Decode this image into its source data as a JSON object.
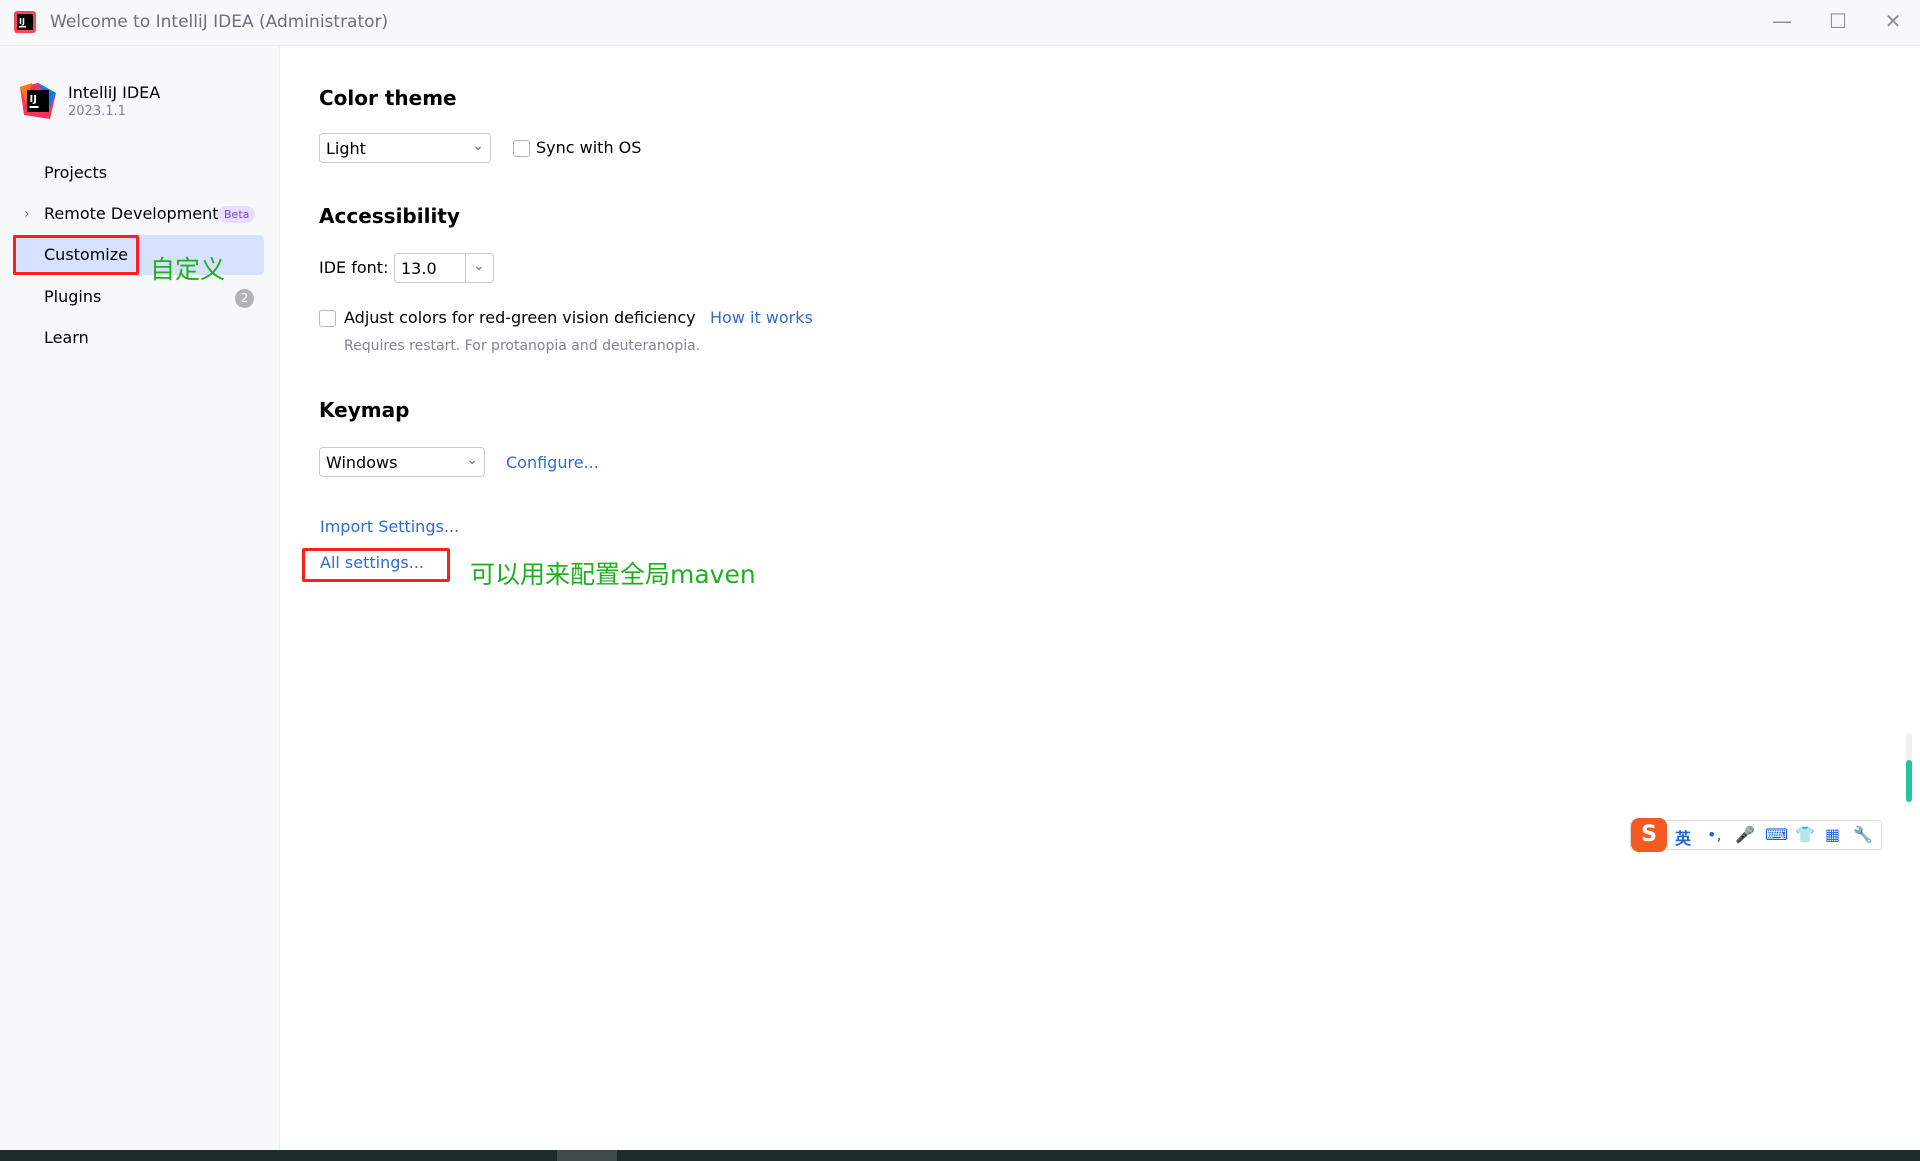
{
  "window": {
    "title": "Welcome to IntelliJ IDEA (Administrator)",
    "minimize_glyph": "—",
    "maximize_glyph": "☐",
    "close_glyph": "✕"
  },
  "brand": {
    "name": "IntelliJ IDEA",
    "version": "2023.1.1",
    "logo_text": "IJ"
  },
  "sidebar": {
    "items": [
      {
        "label": "Projects"
      },
      {
        "label": "Remote Development",
        "badge": "Beta"
      },
      {
        "label": "Customize",
        "selected": true
      },
      {
        "label": "Plugins",
        "count": "2"
      },
      {
        "label": "Learn"
      }
    ]
  },
  "annotations": {
    "customize_note": "自定义",
    "all_settings_note": "可以用来配置全局maven"
  },
  "customize": {
    "color_theme": {
      "heading": "Color theme",
      "selected": "Light",
      "sync_label": "Sync with OS",
      "sync_checked": false
    },
    "accessibility": {
      "heading": "Accessibility",
      "ide_font_label": "IDE font:",
      "ide_font_value": "13.0",
      "adjust_label": "Adjust colors for red-green vision deficiency",
      "adjust_checked": false,
      "how_it_works": "How it works",
      "hint": "Requires restart. For protanopia and deuteranopia."
    },
    "keymap": {
      "heading": "Keymap",
      "selected": "Windows",
      "configure": "Configure..."
    },
    "import_settings": "Import Settings...",
    "all_settings": "All settings..."
  },
  "ime_toolbar": {
    "logo": "S",
    "mode": "英",
    "punct": "•,",
    "mic": "🎤",
    "keyboard": "⌨",
    "skin": "👕",
    "apps": "▦",
    "tools": "🔧"
  },
  "colors": {
    "accent_link": "#2e6bd4",
    "selection": "#d5e1ff",
    "annotation_red": "#ff1e1e",
    "annotation_green": "#1db11d"
  }
}
